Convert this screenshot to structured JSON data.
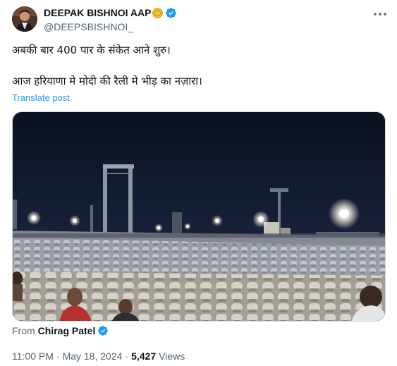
{
  "author": {
    "display_name": "DEEPAK BISHNOI AAP",
    "handle": "@DEEPSBISHNOI_",
    "badge_icon": "gold-coin-icon",
    "verified_icon": "verified-badge-icon",
    "verified_color": "#1d9bf0"
  },
  "more_icon": "more-options-icon",
  "tweet": {
    "line1": "अबकी बार 400 पार के संकेत आने शुरु।",
    "line2": "आज हरियाणा मे मोदी की रैली मे भीड़ का नज़ारा।",
    "translate_label": "Translate post"
  },
  "media": {
    "description_icon": "video-thumbnail"
  },
  "source": {
    "from_label": "From",
    "from_name": "Chirag Patel"
  },
  "meta": {
    "time": "11:00 PM",
    "date": "May 18, 2024",
    "separator": "·",
    "views_count": "5,427",
    "views_label": "Views"
  },
  "colors": {
    "accent": "#1d9bf0",
    "text_primary": "#0f1419",
    "text_secondary": "#536471"
  }
}
